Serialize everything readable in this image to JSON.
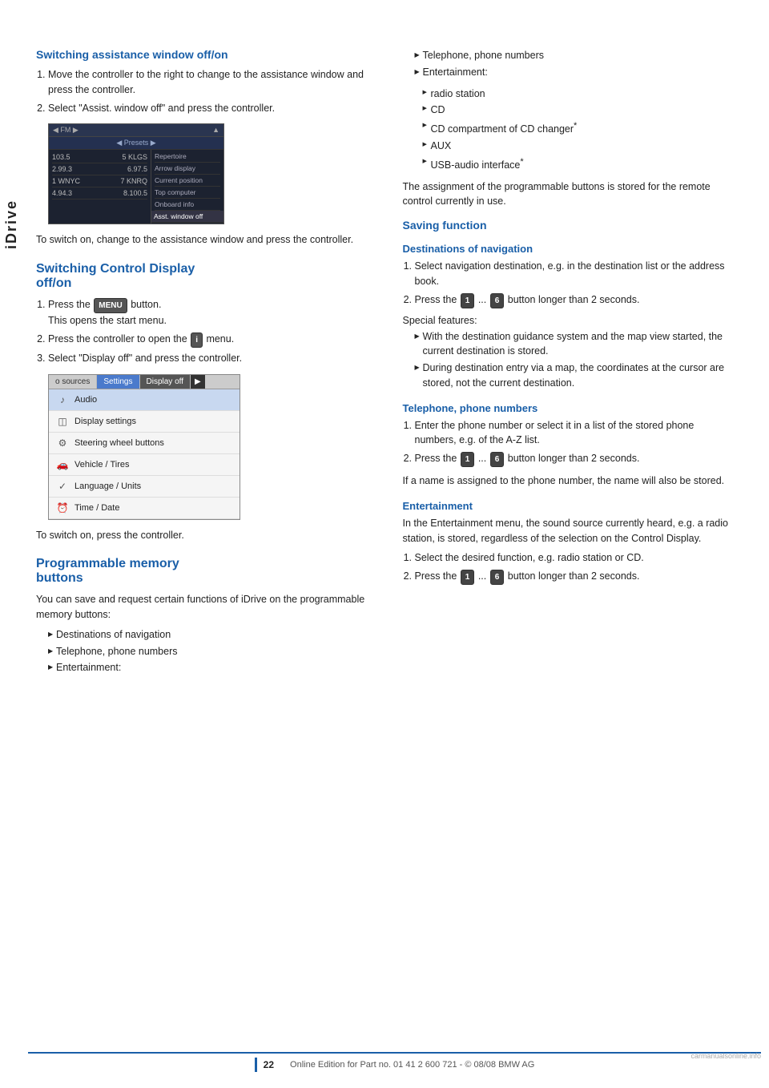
{
  "sidebar": {
    "label": "iDrive"
  },
  "left_col": {
    "section1": {
      "heading": "Switching assistance window off/on",
      "steps": [
        "Move the controller to the right to change to the assistance window and press the controller.",
        "Select \"Assist. window off\" and press the controller."
      ],
      "after_text": "To switch on, change to the assistance window and press the controller."
    },
    "section2": {
      "heading": "Switching Control Display off/on",
      "steps": [
        {
          "text_before": "Press the ",
          "key": "MENU",
          "text_after": " button. This opens the start menu."
        },
        {
          "text_before": "Press the controller to open the ",
          "key": "i",
          "text_after": " menu."
        },
        {
          "text_before": "Select \"Display off\" and press the controller."
        }
      ],
      "after_text": "To switch on, press the controller."
    },
    "section3": {
      "heading": "Programmable memory buttons",
      "intro": "You can save and request certain functions of iDrive on the programmable memory buttons:",
      "bullets": [
        "Destinations of navigation",
        "Telephone, phone numbers",
        "Entertainment:",
        "radio station",
        "CD",
        "CD compartment of CD changer*",
        "AUX",
        "USB-audio interface*"
      ]
    }
  },
  "right_col": {
    "bullets_top": [
      "Telephone, phone numbers",
      "Entertainment:",
      "radio station",
      "CD",
      "CD compartment of CD changer*",
      "AUX",
      "USB-audio interface*"
    ],
    "stored_text": "The assignment of the programmable buttons is stored for the remote control currently in use.",
    "saving_function": {
      "heading": "Saving function",
      "destinations": {
        "sub_heading": "Destinations of navigation",
        "steps": [
          "Select navigation destination, e.g. in the destination list or the address book.",
          {
            "text_before": "Press the ",
            "key1": "1",
            "ellipsis": " ... ",
            "key2": "6",
            "text_after": " button longer than 2 seconds."
          }
        ],
        "special_features": "Special features:",
        "bullets": [
          "With the destination guidance system and the map view started, the current destination is stored.",
          "During destination entry via a map, the coordinates at the cursor are stored, not the current destination."
        ]
      },
      "telephone": {
        "sub_heading": "Telephone, phone numbers",
        "steps": [
          "Enter the phone number or select it in a list of the stored phone numbers, e.g. of the A-Z list.",
          {
            "text_before": "Press the ",
            "key1": "1",
            "ellipsis": " ... ",
            "key2": "6",
            "text_after": " button longer than 2 seconds."
          }
        ],
        "after_text": "If a name is assigned to the phone number, the name will also be stored."
      },
      "entertainment": {
        "sub_heading": "Entertainment",
        "intro": "In the Entertainment menu, the sound source currently heard, e.g. a radio station, is stored, regardless of the selection on the Control Display.",
        "steps": [
          "Select the desired function, e.g. radio station or CD.",
          {
            "text_before": "Press the ",
            "key1": "1",
            "ellipsis": " ... ",
            "key2": "6",
            "text_after": " button longer than 2 seconds."
          }
        ]
      }
    }
  },
  "radio_screen": {
    "top_bar_left": "◀  FM ▶",
    "top_bar_right": "▲",
    "presets": "◀ Presets ▶",
    "stations": [
      {
        "name": "103.5",
        "freq": "5 KLG5"
      },
      {
        "name": "2.99.3",
        "freq": "6.97.5"
      },
      {
        "name": "1 WNYC",
        "freq": "7 KNRQ"
      },
      {
        "name": "4.94.3",
        "freq": "8.100.5"
      }
    ],
    "menu_items": [
      "Repertoire",
      "Arrow display",
      "Current position",
      "Top computer",
      "Onboard info",
      "Asst. window off"
    ]
  },
  "settings_screen": {
    "tabs": [
      "o sources",
      "Settings",
      "Display off",
      "▶"
    ],
    "menu_items": [
      {
        "icon": "♪",
        "label": "Audio"
      },
      {
        "icon": "◫",
        "label": "Display settings"
      },
      {
        "icon": "⚙",
        "label": "Steering wheel buttons"
      },
      {
        "icon": "🚗",
        "label": "Vehicle / Tires"
      },
      {
        "icon": "✓",
        "label": "Language / Units"
      },
      {
        "icon": "🕐",
        "label": "Time / Date"
      }
    ]
  },
  "footer": {
    "page_number": "22",
    "text": "Online Edition for Part no. 01 41 2 600 721 - © 08/08 BMW AG"
  }
}
